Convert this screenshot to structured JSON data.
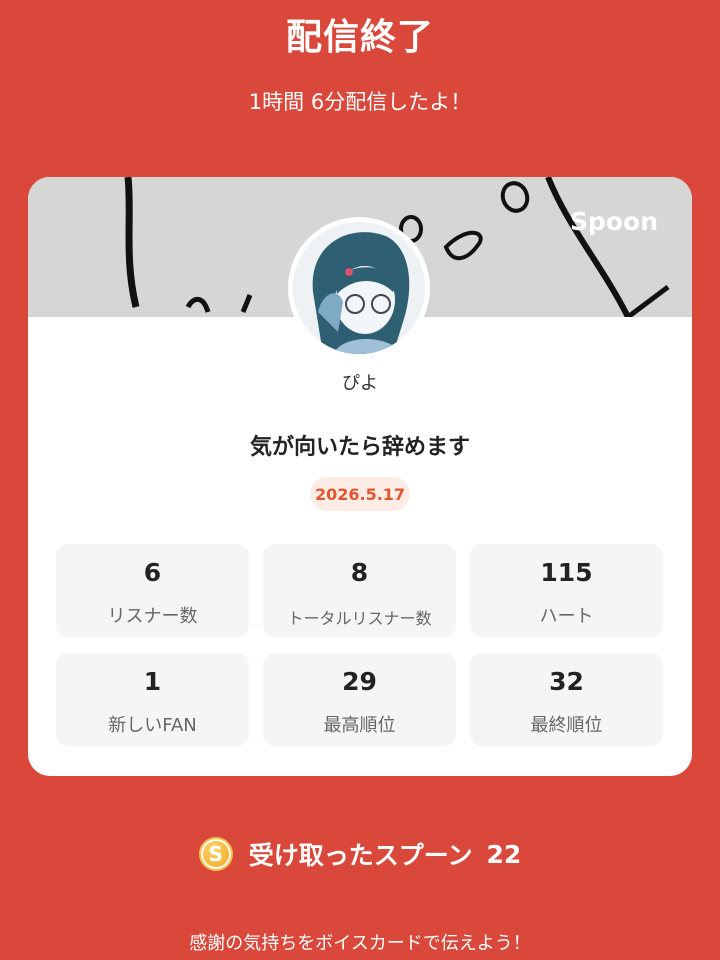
{
  "header": {
    "title": "配信終了",
    "duration_text": "1時間 6分配信したよ！"
  },
  "card": {
    "brand": "Spoon",
    "username": "ぴよ",
    "live_title": "気が向いたら辞めます",
    "date": "2026.5.17",
    "stats": [
      {
        "value": "6",
        "label": "リスナー数"
      },
      {
        "value": "8",
        "label": "トータルリスナー数"
      },
      {
        "value": "115",
        "label": "ハート"
      },
      {
        "value": "1",
        "label": "新しいFAN"
      },
      {
        "value": "29",
        "label": "最高順位"
      },
      {
        "value": "32",
        "label": "最終順位"
      }
    ]
  },
  "spoons": {
    "icon_letter": "S",
    "label": "受け取ったスプーン",
    "count": "22"
  },
  "footer": {
    "thanks_text": "感謝の気持ちをボイスカードで伝えよう！"
  },
  "colors": {
    "background": "#d9483b",
    "date_badge_text": "#e2552f",
    "coin": "#f0a21c"
  }
}
